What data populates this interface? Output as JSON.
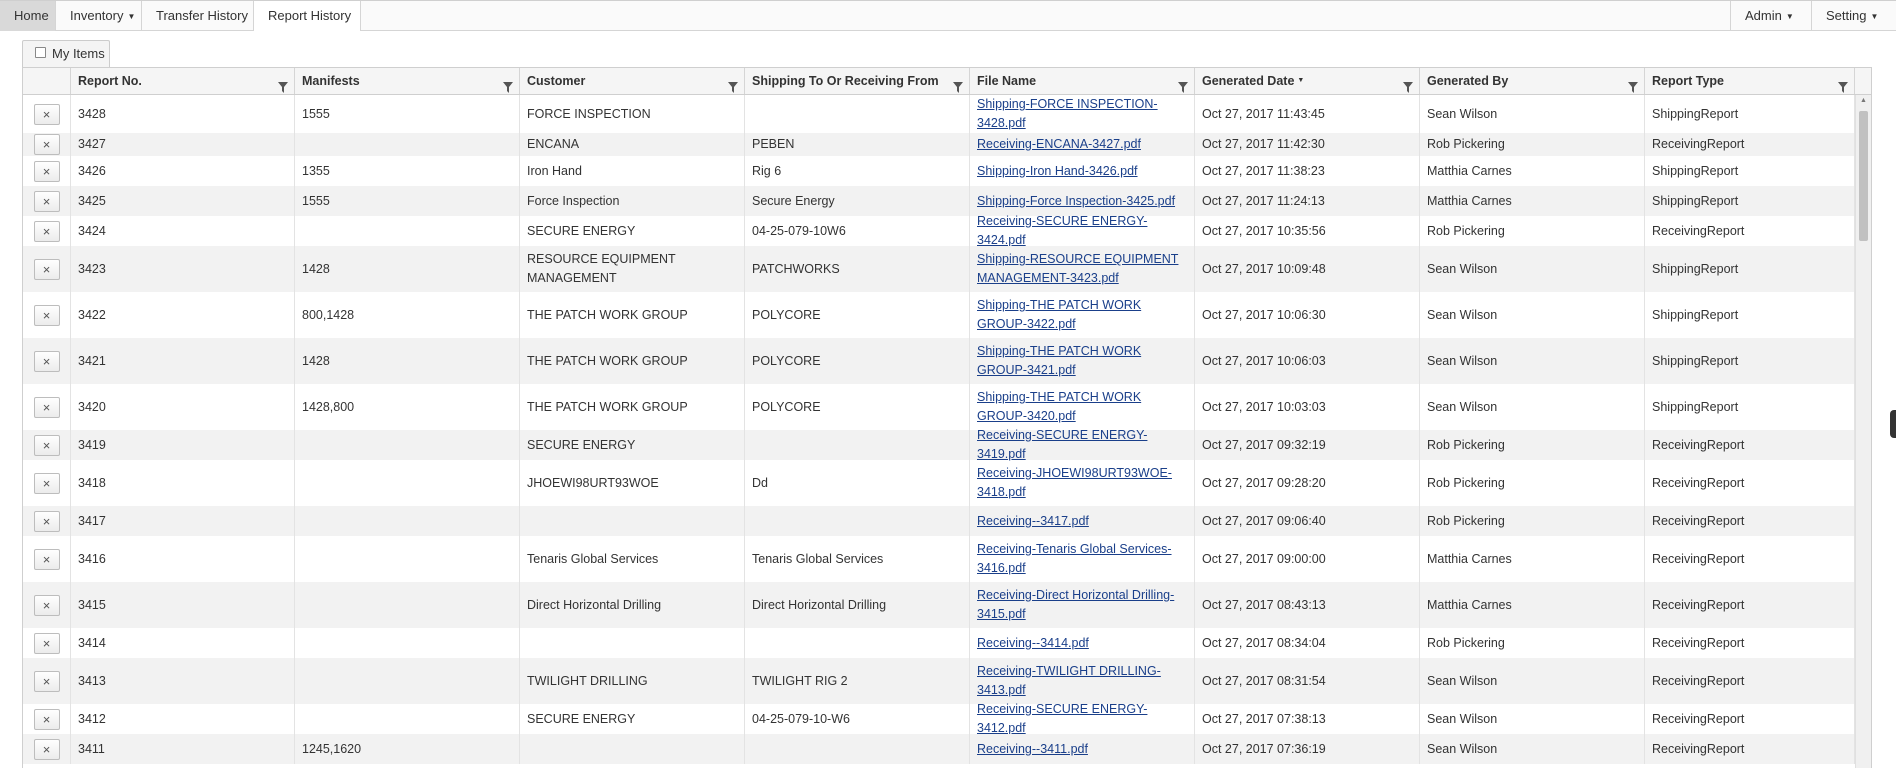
{
  "nav": {
    "home": "Home",
    "inventory": "Inventory",
    "transfer_history": "Transfer History",
    "report_history": "Report History",
    "admin": "Admin",
    "setting": "Setting"
  },
  "toolbar": {
    "my_items": "My Items",
    "my_items_checked": false
  },
  "grid": {
    "headers": [
      "Report No.",
      "Manifests",
      "Customer",
      "Shipping To Or Receiving From",
      "File Name",
      "Generated Date",
      "Generated By",
      "Report Type"
    ],
    "sorted_column": "Generated Date",
    "delete_glyph": "×",
    "rows": [
      {
        "no": "3428",
        "manifests": "1555",
        "customer": "FORCE INSPECTION",
        "shipto": "",
        "file": "Shipping-FORCE INSPECTION-3428.pdf",
        "date": "Oct 27, 2017 11:43:45",
        "by": "Sean Wilson",
        "type": "ShippingReport"
      },
      {
        "no": "3427",
        "manifests": "",
        "customer": "ENCANA",
        "shipto": "PEBEN",
        "file": "Receiving-ENCANA-3427.pdf",
        "date": "Oct 27, 2017 11:42:30",
        "by": "Rob Pickering",
        "type": "ReceivingReport"
      },
      {
        "no": "3426",
        "manifests": "1355",
        "customer": "Iron Hand",
        "shipto": "Rig 6",
        "file": "Shipping-Iron Hand-3426.pdf",
        "date": "Oct 27, 2017 11:38:23",
        "by": "Matthia Carnes",
        "type": "ShippingReport"
      },
      {
        "no": "3425",
        "manifests": "1555",
        "customer": "Force Inspection",
        "shipto": "Secure Energy",
        "file": "Shipping-Force Inspection-3425.pdf",
        "date": "Oct 27, 2017 11:24:13",
        "by": "Matthia Carnes",
        "type": "ShippingReport"
      },
      {
        "no": "3424",
        "manifests": "",
        "customer": "SECURE ENERGY",
        "shipto": "04-25-079-10W6",
        "file": "Receiving-SECURE ENERGY-3424.pdf",
        "date": "Oct 27, 2017 10:35:56",
        "by": "Rob Pickering",
        "type": "ReceivingReport"
      },
      {
        "no": "3423",
        "manifests": "1428",
        "customer": "RESOURCE EQUIPMENT MANAGEMENT",
        "shipto": "PATCHWORKS",
        "file": "Shipping-RESOURCE EQUIPMENT MANAGEMENT-3423.pdf",
        "date": "Oct 27, 2017 10:09:48",
        "by": "Sean Wilson",
        "type": "ShippingReport"
      },
      {
        "no": "3422",
        "manifests": "800,1428",
        "customer": "THE PATCH WORK GROUP",
        "shipto": "POLYCORE",
        "file": "Shipping-THE PATCH WORK GROUP-3422.pdf",
        "date": "Oct 27, 2017 10:06:30",
        "by": "Sean Wilson",
        "type": "ShippingReport"
      },
      {
        "no": "3421",
        "manifests": "1428",
        "customer": "THE PATCH WORK GROUP",
        "shipto": "POLYCORE",
        "file": "Shipping-THE PATCH WORK GROUP-3421.pdf",
        "date": "Oct 27, 2017 10:06:03",
        "by": "Sean Wilson",
        "type": "ShippingReport"
      },
      {
        "no": "3420",
        "manifests": "1428,800",
        "customer": "THE PATCH WORK GROUP",
        "shipto": "POLYCORE",
        "file": "Shipping-THE PATCH WORK GROUP-3420.pdf",
        "date": "Oct 27, 2017 10:03:03",
        "by": "Sean Wilson",
        "type": "ShippingReport"
      },
      {
        "no": "3419",
        "manifests": "",
        "customer": "SECURE ENERGY",
        "shipto": "",
        "file": "Receiving-SECURE ENERGY-3419.pdf",
        "date": "Oct 27, 2017 09:32:19",
        "by": "Rob Pickering",
        "type": "ReceivingReport"
      },
      {
        "no": "3418",
        "manifests": "",
        "customer": "JHOEWI98URT93WOE",
        "shipto": "Dd",
        "file": "Receiving-JHOEWI98URT93WOE-3418.pdf",
        "date": "Oct 27, 2017 09:28:20",
        "by": "Rob Pickering",
        "type": "ReceivingReport"
      },
      {
        "no": "3417",
        "manifests": "",
        "customer": "",
        "shipto": "",
        "file": "Receiving--3417.pdf",
        "date": "Oct 27, 2017 09:06:40",
        "by": "Rob Pickering",
        "type": "ReceivingReport"
      },
      {
        "no": "3416",
        "manifests": "",
        "customer": "Tenaris Global Services",
        "shipto": "Tenaris Global Services",
        "file": "Receiving-Tenaris Global Services-3416.pdf",
        "date": "Oct 27, 2017 09:00:00",
        "by": "Matthia Carnes",
        "type": "ReceivingReport"
      },
      {
        "no": "3415",
        "manifests": "",
        "customer": "Direct Horizontal Drilling",
        "shipto": "Direct Horizontal Drilling",
        "file": "Receiving-Direct Horizontal Drilling-3415.pdf",
        "date": "Oct 27, 2017 08:43:13",
        "by": "Matthia Carnes",
        "type": "ReceivingReport"
      },
      {
        "no": "3414",
        "manifests": "",
        "customer": "",
        "shipto": "",
        "file": "Receiving--3414.pdf",
        "date": "Oct 27, 2017 08:34:04",
        "by": "Rob Pickering",
        "type": "ReceivingReport"
      },
      {
        "no": "3413",
        "manifests": "",
        "customer": "TWILIGHT DRILLING",
        "shipto": "TWILIGHT RIG 2",
        "file": "Receiving-TWILIGHT DRILLING-3413.pdf",
        "date": "Oct 27, 2017 08:31:54",
        "by": "Sean Wilson",
        "type": "ReceivingReport"
      },
      {
        "no": "3412",
        "manifests": "",
        "customer": "SECURE ENERGY",
        "shipto": "04-25-079-10-W6",
        "file": "Receiving-SECURE ENERGY-3412.pdf",
        "date": "Oct 27, 2017 07:38:13",
        "by": "Sean Wilson",
        "type": "ReceivingReport"
      },
      {
        "no": "3411",
        "manifests": "1245,1620",
        "customer": "",
        "shipto": "",
        "file": "Receiving--3411.pdf",
        "date": "Oct 27, 2017 07:36:19",
        "by": "Sean Wilson",
        "type": "ReceivingReport"
      }
    ]
  }
}
